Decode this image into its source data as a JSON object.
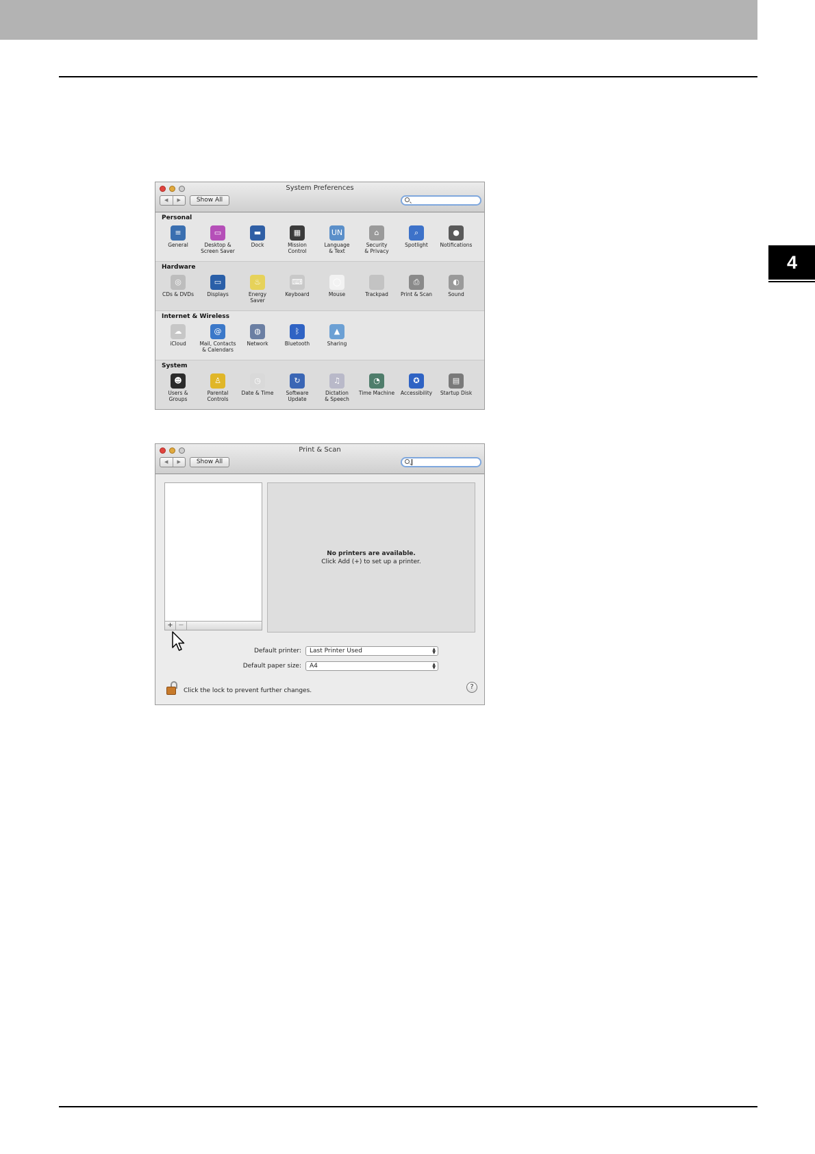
{
  "chapter_tab": "4",
  "system_preferences": {
    "title": "System Preferences",
    "nav_back": "◀",
    "nav_forward": "▶",
    "show_all": "Show All",
    "sections": [
      {
        "title": "Personal",
        "items": [
          {
            "label": "General",
            "icon": "general-icon",
            "color": "#3a6fb0",
            "glyph": "≡"
          },
          {
            "label": "Desktop &\nScreen Saver",
            "icon": "desktop-screen-saver-icon",
            "color": "#b54fb8",
            "glyph": "▭"
          },
          {
            "label": "Dock",
            "icon": "dock-icon",
            "color": "#2f5fa5",
            "glyph": "▬"
          },
          {
            "label": "Mission\nControl",
            "icon": "mission-control-icon",
            "color": "#3b3b3b",
            "glyph": "▦"
          },
          {
            "label": "Language\n& Text",
            "icon": "language-text-icon",
            "color": "#5b8fc9",
            "glyph": "UN"
          },
          {
            "label": "Security\n& Privacy",
            "icon": "security-privacy-icon",
            "color": "#9a9a9a",
            "glyph": "⌂"
          },
          {
            "label": "Spotlight",
            "icon": "spotlight-icon",
            "color": "#3d72c9",
            "glyph": "⌕"
          },
          {
            "label": "Notifications",
            "icon": "notifications-icon",
            "color": "#5a5a5a",
            "glyph": "●"
          }
        ]
      },
      {
        "title": "Hardware",
        "items": [
          {
            "label": "CDs & DVDs",
            "icon": "cds-dvds-icon",
            "color": "#bdbdbd",
            "glyph": "◎"
          },
          {
            "label": "Displays",
            "icon": "displays-icon",
            "color": "#2a5fa8",
            "glyph": "▭"
          },
          {
            "label": "Energy\nSaver",
            "icon": "energy-saver-icon",
            "color": "#e6d25a",
            "glyph": "♨"
          },
          {
            "label": "Keyboard",
            "icon": "keyboard-icon",
            "color": "#c9c9c9",
            "glyph": "⌨"
          },
          {
            "label": "Mouse",
            "icon": "mouse-icon",
            "color": "#f2f2f2",
            "glyph": "◯"
          },
          {
            "label": "Trackpad",
            "icon": "trackpad-icon",
            "color": "#c3c3c3",
            "glyph": " "
          },
          {
            "label": "Print & Scan",
            "icon": "print-scan-icon",
            "color": "#8a8a8a",
            "glyph": "⎙"
          },
          {
            "label": "Sound",
            "icon": "sound-icon",
            "color": "#9a9a9a",
            "glyph": "◐"
          }
        ]
      },
      {
        "title": "Internet & Wireless",
        "items": [
          {
            "label": "iCloud",
            "icon": "icloud-icon",
            "color": "#c7c7c7",
            "glyph": "☁"
          },
          {
            "label": "Mail, Contacts\n& Calendars",
            "icon": "mail-contacts-calendars-icon",
            "color": "#3b78c9",
            "glyph": "@"
          },
          {
            "label": "Network",
            "icon": "network-icon",
            "color": "#6b7fa3",
            "glyph": "◍"
          },
          {
            "label": "Bluetooth",
            "icon": "bluetooth-icon",
            "color": "#2f63c4",
            "glyph": "ᛒ"
          },
          {
            "label": "Sharing",
            "icon": "sharing-icon",
            "color": "#6ca0d4",
            "glyph": "▲"
          }
        ]
      },
      {
        "title": "System",
        "items": [
          {
            "label": "Users &\nGroups",
            "icon": "users-groups-icon",
            "color": "#2b2b2b",
            "glyph": "☻"
          },
          {
            "label": "Parental\nControls",
            "icon": "parental-controls-icon",
            "color": "#e0b628",
            "glyph": "♙"
          },
          {
            "label": "Date & Time",
            "icon": "date-time-icon",
            "color": "#d9d9d9",
            "glyph": "◷"
          },
          {
            "label": "Software\nUpdate",
            "icon": "software-update-icon",
            "color": "#3a66b5",
            "glyph": "↻"
          },
          {
            "label": "Dictation\n& Speech",
            "icon": "dictation-speech-icon",
            "color": "#b9b9c9",
            "glyph": "♫"
          },
          {
            "label": "Time Machine",
            "icon": "time-machine-icon",
            "color": "#4f7d6b",
            "glyph": "◔"
          },
          {
            "label": "Accessibility",
            "icon": "accessibility-icon",
            "color": "#2f63c4",
            "glyph": "✪"
          },
          {
            "label": "Startup Disk",
            "icon": "startup-disk-icon",
            "color": "#7a7a7a",
            "glyph": "▤"
          }
        ]
      }
    ]
  },
  "print_scan": {
    "title": "Print & Scan",
    "nav_back": "◀",
    "nav_forward": "▶",
    "show_all": "Show All",
    "add_button": "+",
    "remove_button": "−",
    "empty_message_line1": "No printers are available.",
    "empty_message_line2": "Click Add (+) to set up a printer.",
    "default_printer_label": "Default printer:",
    "default_printer_value": "Last Printer Used",
    "default_paper_label": "Default paper size:",
    "default_paper_value": "A4",
    "lock_text": "Click the lock to prevent further changes.",
    "help_button": "?"
  }
}
